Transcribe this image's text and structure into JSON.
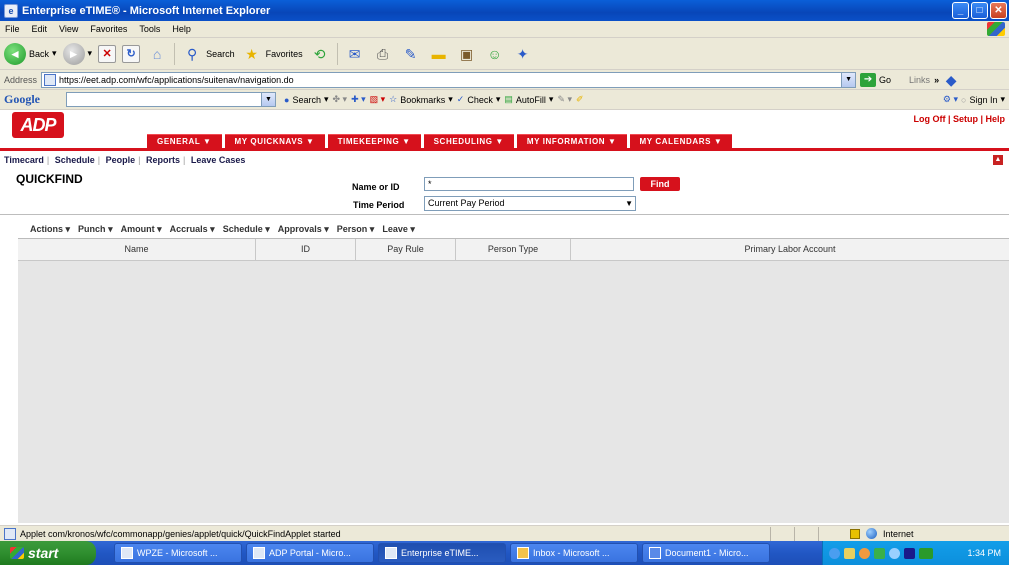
{
  "window": {
    "title": "Enterprise eTIME® - Microsoft Internet Explorer"
  },
  "menu": [
    "File",
    "Edit",
    "View",
    "Favorites",
    "Tools",
    "Help"
  ],
  "toolbar": {
    "back": "Back",
    "search": "Search",
    "favorites": "Favorites"
  },
  "address": {
    "label": "Address",
    "url": "https://eet.adp.com/wfc/applications/suitenav/navigation.do",
    "go": "Go",
    "links": "Links"
  },
  "google": {
    "logo": "Google",
    "search": "Search",
    "bookmarks": "Bookmarks",
    "check": "Check",
    "autofill": "AutoFill",
    "signin": "Sign In"
  },
  "adp": {
    "logo": "ADP",
    "header_links": "Log Off | Setup | Help",
    "nav_tabs": [
      "GENERAL",
      "MY QUICKNAVS",
      "TIMEKEEPING",
      "SCHEDULING",
      "MY INFORMATION",
      "MY CALENDARS"
    ],
    "subnav": [
      "Timecard",
      "Schedule",
      "People",
      "Reports",
      "Leave Cases"
    ]
  },
  "quickfind": {
    "title": "QUICKFIND",
    "name_label": "Name or ID",
    "name_value": "*",
    "find": "Find",
    "period_label": "Time Period",
    "period_value": "Current Pay Period"
  },
  "actions": [
    "Actions",
    "Punch",
    "Amount",
    "Accruals",
    "Schedule",
    "Approvals",
    "Person",
    "Leave"
  ],
  "columns": [
    "Name",
    "ID",
    "Pay Rule",
    "Person Type",
    "Primary Labor Account"
  ],
  "status": {
    "message": "Applet com/kronos/wfc/commonapp/genies/applet/quick/QuickFindApplet started",
    "zone": "Internet"
  },
  "taskbar": {
    "start": "start",
    "tasks": [
      "WPZE - Microsoft ...",
      "ADP Portal - Micro...",
      "Enterprise eTIME...",
      "Inbox - Microsoft ...",
      "Document1 - Micro..."
    ],
    "clock": "1:34 PM"
  }
}
